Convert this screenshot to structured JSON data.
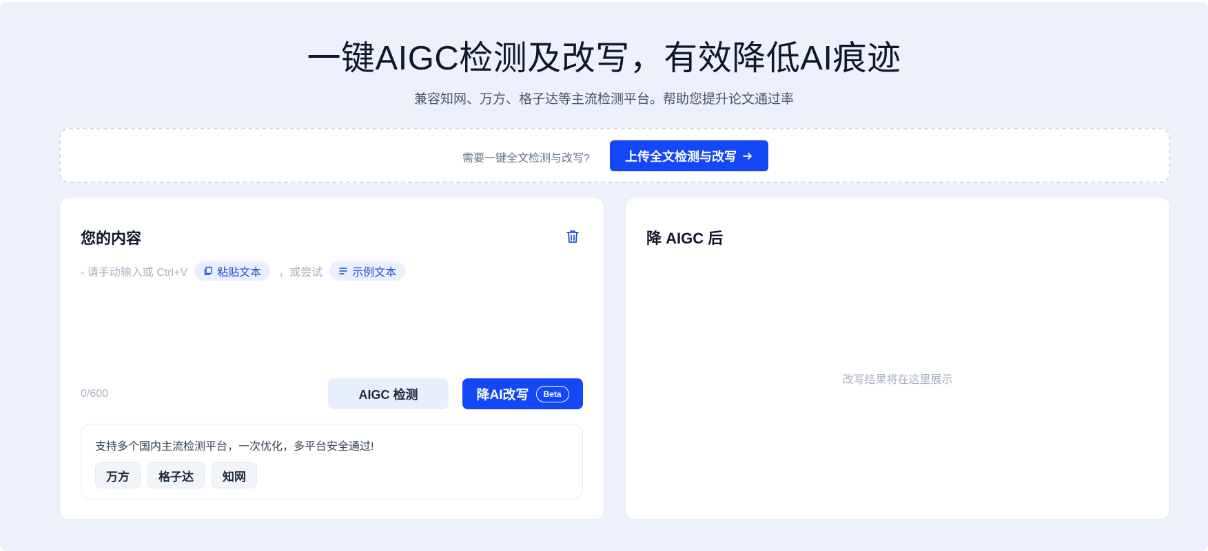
{
  "hero": {
    "title": "一键AIGC检测及改写，有效降低AI痕迹",
    "subtitle": "兼容知网、万方、格子达等主流检测平台。帮助您提升论文通过率"
  },
  "upload": {
    "prompt": "需要一键全文检测与改写?",
    "button_label": "上传全文检测与改写",
    "button_icon": "arrow-right-icon"
  },
  "input_panel": {
    "title": "您的内容",
    "delete_icon": "trash-icon",
    "hint_prefix": "- 请手动输入或 Ctrl+V",
    "paste_label": "粘贴文本",
    "hint_middle": "，或尝试",
    "sample_label": "示例文本",
    "counter": "0/600",
    "detect_label": "AIGC 检测",
    "rewrite_label": "降AI改写",
    "beta_label": "Beta",
    "platform_text": "支持多个国内主流检测平台，一次优化，多平台安全通过!",
    "platforms": [
      "万方",
      "格子达",
      "知网"
    ]
  },
  "output_panel": {
    "title": "降 AIGC 后",
    "placeholder": "改写结果将在这里展示"
  },
  "colors": {
    "accent": "#1447f5",
    "background": "#edf1fc"
  }
}
